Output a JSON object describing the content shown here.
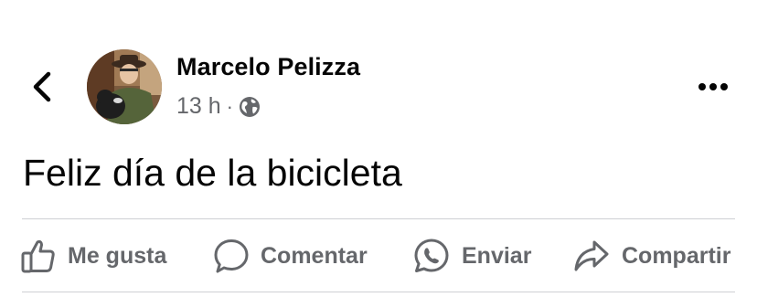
{
  "post": {
    "author": "Marcelo Pelizza",
    "time": "13 h",
    "separator": "·",
    "audience_icon": "globe-icon",
    "text": "Feliz día de la bicicleta"
  },
  "header": {
    "back_icon": "chevron-left-icon",
    "more_icon": "more-horizontal-icon"
  },
  "actions": {
    "like_label": "Me gusta",
    "comment_label": "Comentar",
    "send_label": "Enviar",
    "share_label": "Compartir"
  },
  "colors": {
    "text_primary": "#050505",
    "text_secondary": "#65676b",
    "divider": "#ced0d4"
  }
}
